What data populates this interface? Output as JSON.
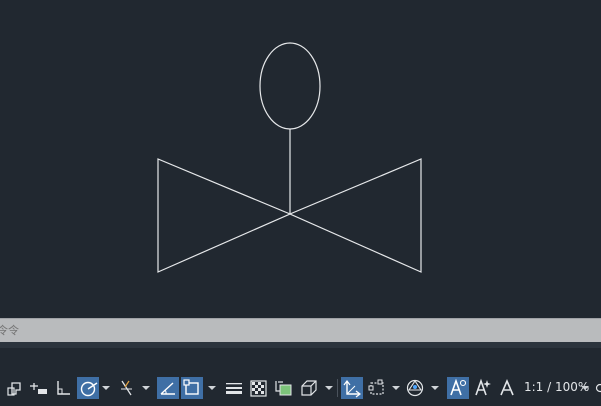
{
  "command_line": {
    "placeholder": "令令"
  },
  "status_bar": {
    "annotation_scale": "1:1 / 100%",
    "buttons": [
      {
        "icon": "model-space-icon",
        "active": false
      },
      {
        "icon": "grid-snap-icon",
        "active": false
      },
      {
        "icon": "ortho-icon",
        "active": false
      },
      {
        "icon": "polar-tracking-icon",
        "active": true
      },
      {
        "icon": "isodraft-icon",
        "active": false
      },
      {
        "icon": "dynamic-ucs-icon",
        "active": true
      },
      {
        "icon": "object-snap-icon",
        "active": true
      },
      {
        "icon": "lineweight-icon",
        "active": false
      },
      {
        "icon": "transparency-icon",
        "active": false
      },
      {
        "icon": "selection-cycling-icon",
        "active": false
      },
      {
        "icon": "3d-osnap-icon",
        "active": false
      },
      {
        "icon": "dynamic-input-icon",
        "active": true
      },
      {
        "icon": "selection-filter-icon",
        "active": false
      },
      {
        "icon": "gizmo-icon",
        "active": false
      },
      {
        "icon": "annotation-visibility-icon",
        "active": true
      },
      {
        "icon": "auto-scale-icon",
        "active": false
      },
      {
        "icon": "annotation-scale-icon",
        "active": false
      }
    ]
  },
  "colors": {
    "canvas_bg": "#212830",
    "drawing_lines": "#e6e8ea",
    "command_bg": "#b9bbbd",
    "active_button": "#3f6fa5"
  }
}
